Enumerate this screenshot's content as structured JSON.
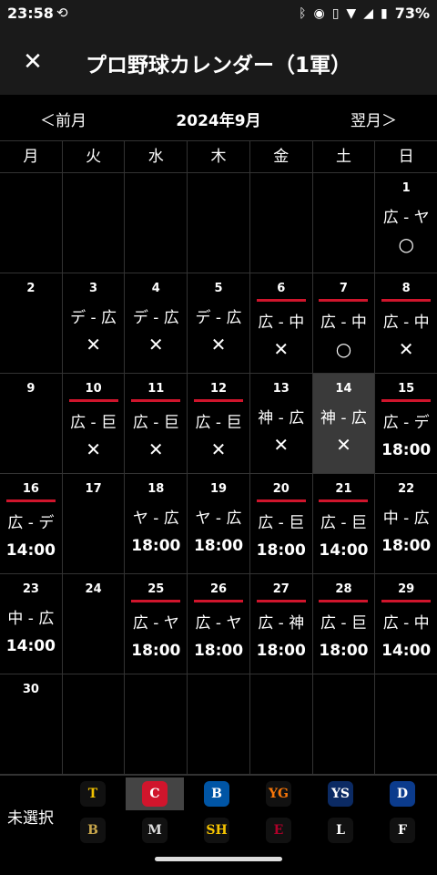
{
  "status_bar": {
    "time": "23:58",
    "battery": "73%"
  },
  "app_bar": {
    "title": "プロ野球カレンダー（1軍）",
    "close_icon": "close-icon"
  },
  "month_nav": {
    "prev": "＜前月",
    "current": "2024年9月",
    "next": "翌月＞"
  },
  "weekdays": [
    "月",
    "火",
    "水",
    "木",
    "金",
    "土",
    "日"
  ],
  "weeks": [
    [
      {
        "day": ""
      },
      {
        "day": ""
      },
      {
        "day": ""
      },
      {
        "day": ""
      },
      {
        "day": ""
      },
      {
        "day": ""
      },
      {
        "day": "1",
        "matchup": "広 - ヤ",
        "result": "○"
      }
    ],
    [
      {
        "day": "2"
      },
      {
        "day": "3",
        "matchup": "デ - 広",
        "result": "✕"
      },
      {
        "day": "4",
        "matchup": "デ - 広",
        "result": "✕"
      },
      {
        "day": "5",
        "matchup": "デ - 広",
        "result": "✕"
      },
      {
        "day": "6",
        "home": true,
        "matchup": "広 - 中",
        "result": "✕"
      },
      {
        "day": "7",
        "home": true,
        "matchup": "広 - 中",
        "result": "○"
      },
      {
        "day": "8",
        "home": true,
        "matchup": "広 - 中",
        "result": "✕"
      }
    ],
    [
      {
        "day": "9"
      },
      {
        "day": "10",
        "home": true,
        "matchup": "広 - 巨",
        "result": "✕"
      },
      {
        "day": "11",
        "home": true,
        "matchup": "広 - 巨",
        "result": "✕"
      },
      {
        "day": "12",
        "home": true,
        "matchup": "広 - 巨",
        "result": "✕"
      },
      {
        "day": "13",
        "matchup": "神 - 広",
        "result": "✕"
      },
      {
        "day": "14",
        "today": true,
        "matchup": "神 - 広",
        "result": "✕"
      },
      {
        "day": "15",
        "home": true,
        "matchup": "広 - デ",
        "time": "18:00"
      }
    ],
    [
      {
        "day": "16",
        "home": true,
        "matchup": "広 - デ",
        "time": "14:00"
      },
      {
        "day": "17"
      },
      {
        "day": "18",
        "matchup": "ヤ - 広",
        "time": "18:00"
      },
      {
        "day": "19",
        "matchup": "ヤ - 広",
        "time": "18:00"
      },
      {
        "day": "20",
        "home": true,
        "matchup": "広 - 巨",
        "time": "18:00"
      },
      {
        "day": "21",
        "home": true,
        "matchup": "広 - 巨",
        "time": "14:00"
      },
      {
        "day": "22",
        "matchup": "中 - 広",
        "time": "18:00"
      }
    ],
    [
      {
        "day": "23",
        "matchup": "中 - 広",
        "time": "14:00"
      },
      {
        "day": "24"
      },
      {
        "day": "25",
        "home": true,
        "matchup": "広 - ヤ",
        "time": "18:00"
      },
      {
        "day": "26",
        "home": true,
        "matchup": "広 - ヤ",
        "time": "18:00"
      },
      {
        "day": "27",
        "home": true,
        "matchup": "広 - 神",
        "time": "18:00"
      },
      {
        "day": "28",
        "home": true,
        "matchup": "広 - 巨",
        "time": "18:00"
      },
      {
        "day": "29",
        "home": true,
        "matchup": "広 - 中",
        "time": "14:00"
      }
    ],
    [
      {
        "day": "30"
      },
      {
        "day": ""
      },
      {
        "day": ""
      },
      {
        "day": ""
      },
      {
        "day": ""
      },
      {
        "day": ""
      },
      {
        "day": ""
      }
    ]
  ],
  "team_selector": {
    "unselected_label": "未選択",
    "teams": [
      {
        "icon": "tigers-logo",
        "glyph": "T",
        "color": "#f2c200",
        "bg": "#111",
        "selected": false
      },
      {
        "icon": "carp-logo",
        "glyph": "C",
        "color": "#fff",
        "bg": "#d0152c",
        "selected": true
      },
      {
        "icon": "baystars-logo",
        "glyph": "B",
        "color": "#fff",
        "bg": "#0055a5",
        "selected": false
      },
      {
        "icon": "giants-logo",
        "glyph": "YG",
        "color": "#f97709",
        "bg": "#111",
        "selected": false
      },
      {
        "icon": "swallows-logo",
        "glyph": "YS",
        "color": "#fff",
        "bg": "#0b2a63",
        "selected": false
      },
      {
        "icon": "dragons-logo",
        "glyph": "D",
        "color": "#fff",
        "bg": "#0b3b8c",
        "selected": false
      },
      {
        "icon": "buffaloes-logo",
        "glyph": "B",
        "color": "#c8a64b",
        "bg": "#111",
        "selected": false
      },
      {
        "icon": "marines-logo",
        "glyph": "M",
        "color": "#ddd",
        "bg": "#111",
        "selected": false
      },
      {
        "icon": "hawks-logo",
        "glyph": "SH",
        "color": "#f6c400",
        "bg": "#111",
        "selected": false
      },
      {
        "icon": "eagles-logo",
        "glyph": "E",
        "color": "#b0002a",
        "bg": "#111",
        "selected": false
      },
      {
        "icon": "lions-logo",
        "glyph": "L",
        "color": "#fff",
        "bg": "#111",
        "selected": false
      },
      {
        "icon": "fighters-logo",
        "glyph": "F",
        "color": "#fff",
        "bg": "#111",
        "selected": false
      }
    ]
  },
  "colors": {
    "home_marker": "#d0152c",
    "today_bg": "#3a3a3a",
    "grid": "#333333"
  }
}
